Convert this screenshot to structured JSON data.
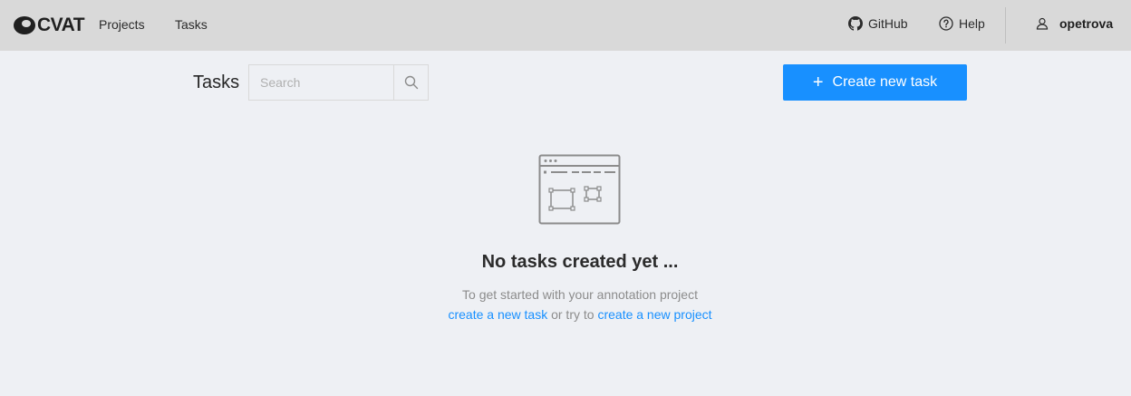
{
  "header": {
    "logo_text": "CVAT",
    "nav": {
      "projects": "Projects",
      "tasks": "Tasks"
    },
    "github_label": "GitHub",
    "help_label": "Help",
    "username": "opetrova"
  },
  "page": {
    "title": "Tasks",
    "search_placeholder": "Search",
    "create_button": "Create new task",
    "create_button_icon": "plus-icon"
  },
  "empty_state": {
    "icon": "empty-tasks-icon",
    "title": "No tasks created yet ...",
    "subtitle": "To get started with your annotation project",
    "link_create_task": "create a new task",
    "middle_text": "or try to",
    "link_create_project": "create a new project"
  },
  "colors": {
    "primary": "#1890ff",
    "header_bg": "#d9d9d9",
    "page_bg": "#eef0f4"
  }
}
